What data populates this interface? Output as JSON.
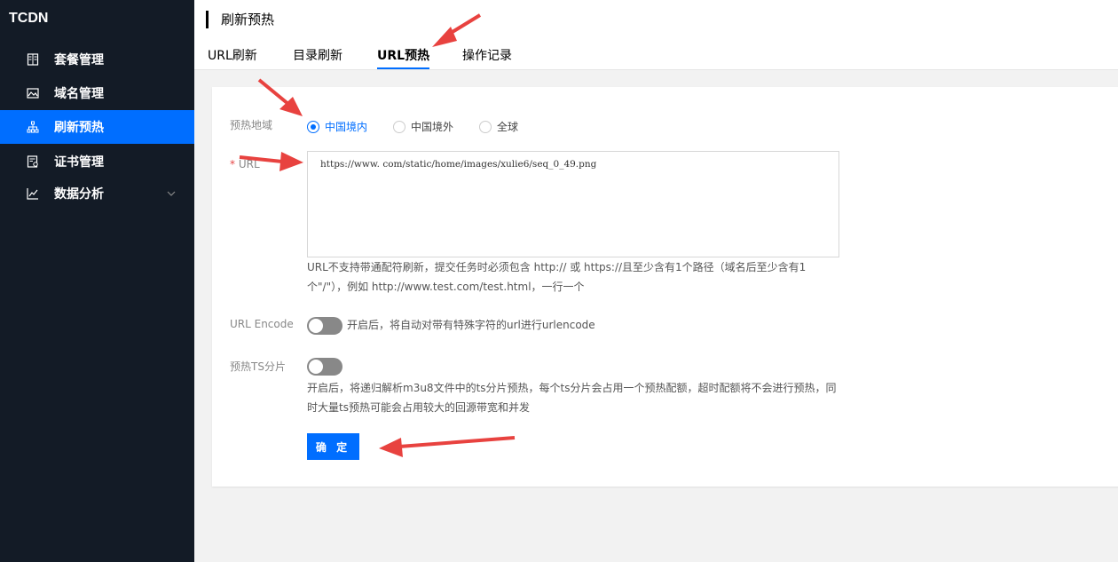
{
  "app": {
    "brand": "TCDN"
  },
  "sidebar": {
    "items": [
      {
        "label": "套餐管理",
        "icon": "package-icon"
      },
      {
        "label": "域名管理",
        "icon": "image-icon"
      },
      {
        "label": "刷新预热",
        "icon": "sitemap-icon",
        "active": true
      },
      {
        "label": "证书管理",
        "icon": "certificate-icon"
      },
      {
        "label": "数据分析",
        "icon": "chart-icon",
        "expandable": true
      }
    ]
  },
  "header": {
    "title": "刷新预热",
    "tabs": [
      {
        "label": "URL刷新"
      },
      {
        "label": "目录刷新"
      },
      {
        "label": "URL预热",
        "active": true
      },
      {
        "label": "操作记录"
      }
    ]
  },
  "form": {
    "region": {
      "label": "预热地域",
      "options": [
        {
          "label": "中国境内",
          "checked": true
        },
        {
          "label": "中国境外",
          "checked": false
        },
        {
          "label": "全球",
          "checked": false
        }
      ]
    },
    "url": {
      "required_mark": "*",
      "label": "URL",
      "value": "https://www.            com/static/home/images/xulie6/seq_0_49.png",
      "help_line1": "URL不支持带通配符刷新，提交任务时必须包含 http:// 或 https://且至少含有1个路径（域名后至少含有1",
      "help_line2": "个\"/\"），例如 http://www.test.com/test.html，一行一个"
    },
    "url_encode": {
      "label": "URL Encode",
      "enabled": false,
      "desc": "开启后，将自动对带有特殊字符的url进行urlencode"
    },
    "ts_split": {
      "label": "预热TS分片",
      "enabled": false,
      "desc_line1": "开启后，将递归解析m3u8文件中的ts分片预热，每个ts分片会占用一个预热配额，超时配额将不会进行预热，同",
      "desc_line2": "时大量ts预热可能会占用较大的回源带宽和并发"
    },
    "submit_label": "确 定"
  },
  "colors": {
    "accent": "#006eff",
    "sidebar_bg": "#131b26",
    "annotation_arrow": "#e8423f"
  }
}
